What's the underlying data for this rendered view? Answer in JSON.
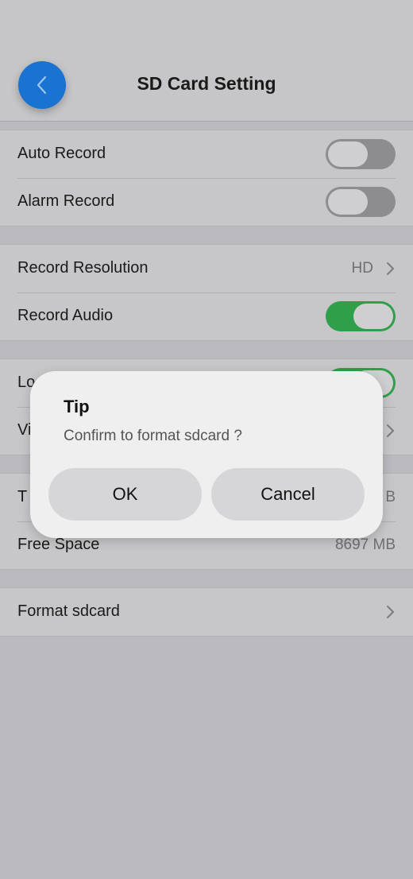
{
  "header": {
    "title": "SD Card Setting"
  },
  "groups": {
    "record": [
      {
        "label": "Auto Record",
        "on": false
      },
      {
        "label": "Alarm Record",
        "on": false
      }
    ],
    "media": {
      "resolution_label": "Record Resolution",
      "resolution_value": "HD",
      "audio_label": "Record Audio",
      "audio_on": true
    },
    "partial": {
      "row1_label": "Lo",
      "row1_on": true,
      "row2_label": "Vi"
    },
    "storage": {
      "total_label": "T",
      "total_value": "B",
      "free_label": "Free Space",
      "free_value": "8697 MB"
    },
    "format": {
      "label": "Format sdcard"
    }
  },
  "dialog": {
    "title": "Tip",
    "message": "Confirm to format sdcard ?",
    "ok": "OK",
    "cancel": "Cancel"
  },
  "colors": {
    "accent_blue": "#1a73d1",
    "toggle_on": "#2f9f4a",
    "toggle_off": "#8d8d90"
  },
  "icons": {
    "back": "chevron-left-icon",
    "arrow": "chevron-right-icon"
  }
}
